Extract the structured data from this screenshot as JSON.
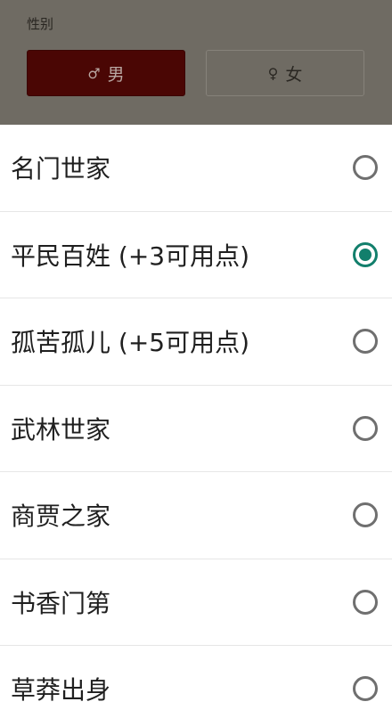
{
  "gender": {
    "label": "性别",
    "male": {
      "symbol": "♂",
      "label": "男",
      "selected": true
    },
    "female": {
      "symbol": "♀",
      "label": "女",
      "selected": false
    }
  },
  "options": [
    {
      "label": "名门世家",
      "checked": false
    },
    {
      "label": "平民百姓 (+3可用点)",
      "checked": true
    },
    {
      "label": "孤苦孤儿 (+5可用点)",
      "checked": false
    },
    {
      "label": "武林世家",
      "checked": false
    },
    {
      "label": "商贾之家",
      "checked": false
    },
    {
      "label": "书香门第",
      "checked": false
    },
    {
      "label": "草莽出身",
      "checked": false
    }
  ],
  "colors": {
    "backdrop": "#6f6b63",
    "male_selected": "#4a0604",
    "radio_accent": "#127f6c"
  }
}
